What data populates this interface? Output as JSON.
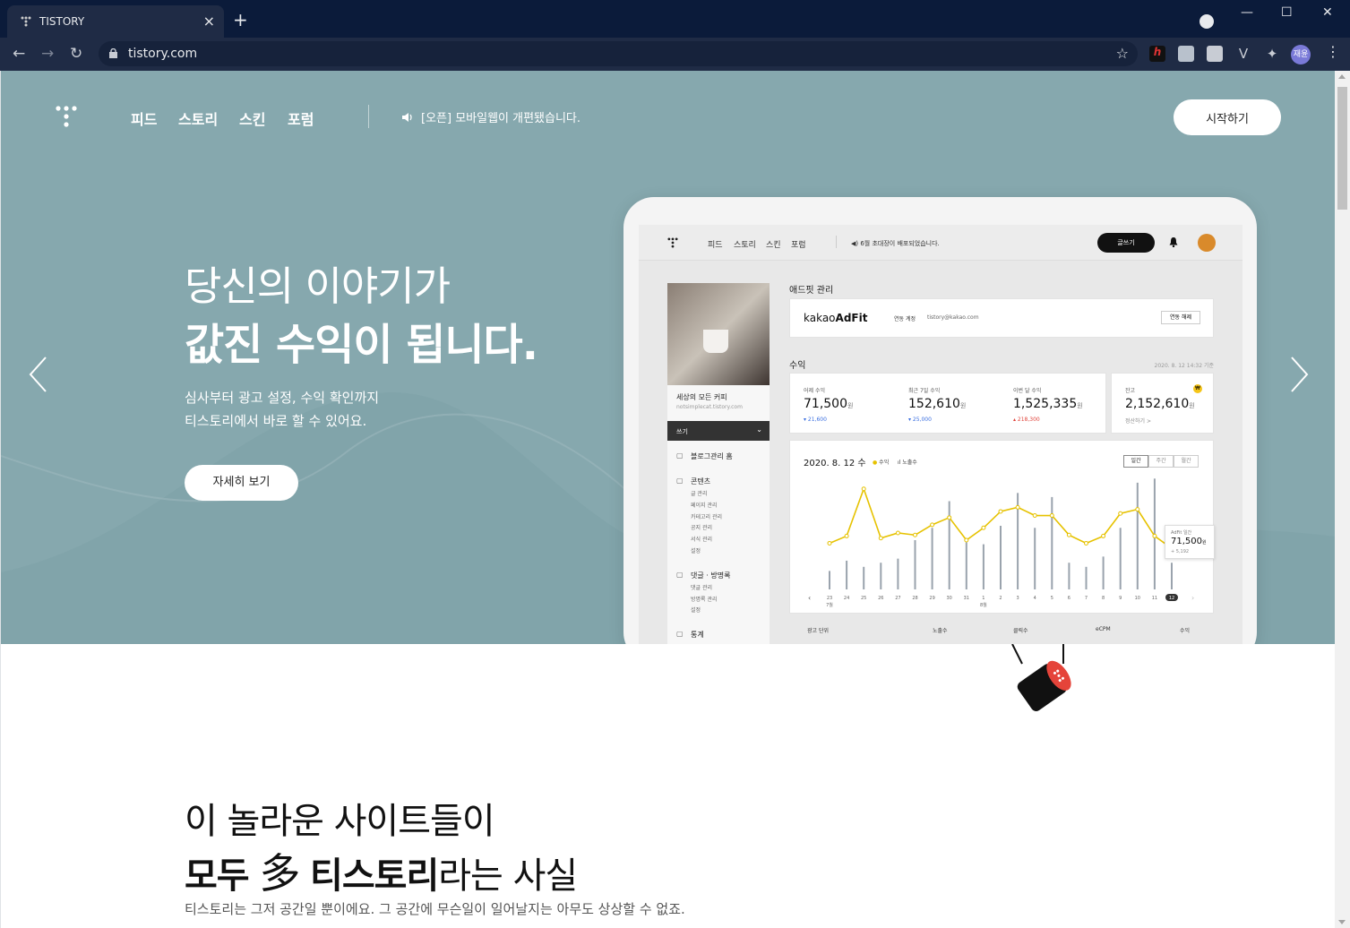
{
  "browser": {
    "tab_title": "TISTORY",
    "url": "tistory.com",
    "avatar_label": "재윤"
  },
  "nav": {
    "menu": [
      "피드",
      "스토리",
      "스킨",
      "포럼"
    ],
    "notice": "[오픈] 모바일웹이 개편됐습니다.",
    "start_label": "시작하기"
  },
  "hero": {
    "headline_line1": "당신의 이야기가",
    "headline_line2": "값진 수익이 됩니다.",
    "sub_line1": "심사부터 광고 설정, 수익 확인까지",
    "sub_line2": "티스토리에서 바로 할 수 있어요.",
    "more_label": "자세히 보기",
    "bg_color": "#86a8ae"
  },
  "mock": {
    "menu": [
      "피드",
      "스토리",
      "스킨",
      "포럼"
    ],
    "notice": "6월 초대장이 배포되었습니다.",
    "write_label": "글쓰기",
    "blog_name": "세상의 모든 커피",
    "blog_url": "notsimplecat.tistory.com",
    "side_bar_label": "쓰기",
    "side_menu": [
      {
        "label": "블로그관리 홈",
        "subs": []
      },
      {
        "label": "콘텐츠",
        "subs": [
          "글 관리",
          "페이지 관리",
          "카테고리 관리",
          "공지 관리",
          "서식 관리",
          "설정"
        ]
      },
      {
        "label": "댓글 · 방명록",
        "subs": [
          "댓글 관리",
          "방명록 관리",
          "설정"
        ]
      },
      {
        "label": "통계",
        "subs": []
      }
    ],
    "adfit_title": "애드핏 관리",
    "adfit_logo_a": "kakao",
    "adfit_logo_b": "AdFit",
    "linked_label": "연동 계정",
    "linked_email": "tistory@kakao.com",
    "unlink_label": "연동 해제",
    "revenue_title": "수익",
    "revenue_time": "2020. 8. 12 14:32 기준",
    "stats": [
      {
        "label": "어제 수익",
        "value": "71,500",
        "unit": "원",
        "delta": "▾ 21,600",
        "delta_color": "#3b6fe0"
      },
      {
        "label": "최근 7일 수익",
        "value": "152,610",
        "unit": "원",
        "delta": "▾ 25,000",
        "delta_color": "#3b6fe0"
      },
      {
        "label": "이번 달 수익",
        "value": "1,525,335",
        "unit": "원",
        "delta": "▴ 218,300",
        "delta_color": "#e0443b"
      }
    ],
    "balance_label": "잔고",
    "balance_value": "2,152,610",
    "balance_unit": "원",
    "balance_link": "정산하기 >",
    "chart_date": "2020. 8. 12 수",
    "legend_revenue": "수익",
    "legend_impressions": "노출수",
    "period_tabs": [
      "일간",
      "주간",
      "월간"
    ],
    "tooltip_label": "AdFit 일간",
    "tooltip_value": "71,500",
    "tooltip_unit": "원",
    "tooltip_sub": "+ 5,192",
    "month_jul": "7월",
    "month_aug": "8월",
    "table_headers": [
      "광고 단위",
      "노출수",
      "클릭수",
      "eCPM",
      "수익"
    ]
  },
  "chart_data": {
    "type": "line",
    "categories": [
      "23",
      "24",
      "25",
      "26",
      "27",
      "28",
      "29",
      "30",
      "31",
      "1",
      "2",
      "3",
      "4",
      "5",
      "6",
      "7",
      "8",
      "9",
      "10",
      "11",
      "12"
    ],
    "series": [
      {
        "name": "수익",
        "values": [
          45,
          52,
          98,
          50,
          55,
          53,
          63,
          70,
          48,
          60,
          76,
          80,
          72,
          72,
          53,
          45,
          52,
          74,
          78,
          52,
          40
        ]
      },
      {
        "name": "노출수",
        "values": [
          18,
          28,
          22,
          26,
          30,
          48,
          60,
          86,
          46,
          44,
          62,
          94,
          60,
          90,
          26,
          22,
          32,
          60,
          104,
          108,
          26
        ]
      }
    ],
    "ylim": [
      0,
      110
    ]
  },
  "section2": {
    "line1": "이 놀라운 사이트들이",
    "line2_a": "모두",
    "line2_kanji": "多",
    "line2_b": "티스토리",
    "line2_c": "라는 사실",
    "desc": "티스토리는 그저 공간일 뿐이에요. 그 공간에 무슨일이 일어날지는 아무도 상상할 수 없죠."
  }
}
